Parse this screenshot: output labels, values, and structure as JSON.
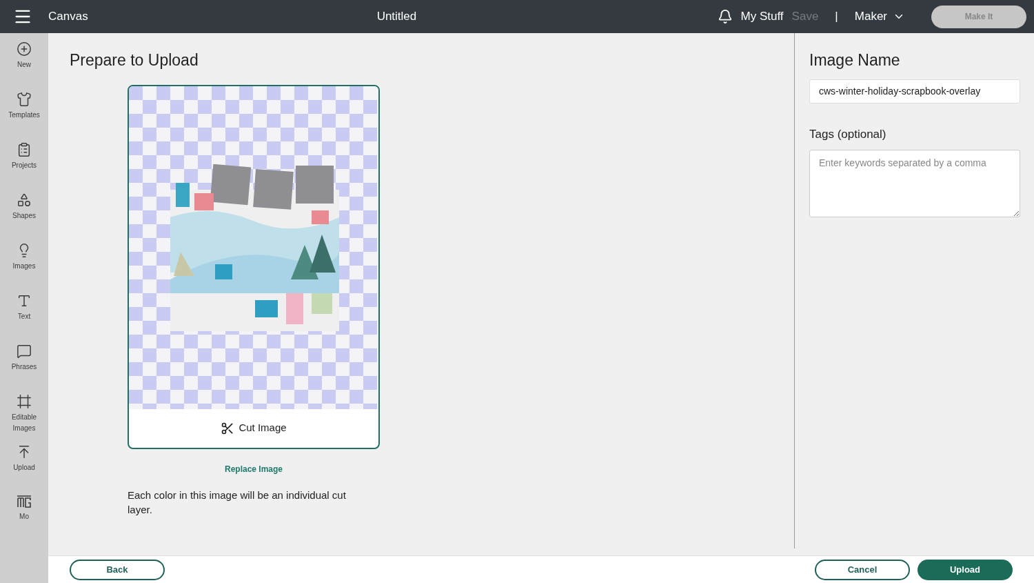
{
  "header": {
    "app_title": "Canvas",
    "document_title": "Untitled",
    "my_stuff": "My Stuff",
    "save": {
      "label": "Save",
      "disabled": true
    },
    "separator": "|",
    "machine": "Maker",
    "make_it": {
      "label": "Make It",
      "disabled": true
    }
  },
  "sidebar": {
    "items": [
      {
        "label": "New"
      },
      {
        "label": "Templates"
      },
      {
        "label": "Projects"
      },
      {
        "label": "Shapes"
      },
      {
        "label": "Images"
      },
      {
        "label": "Text"
      },
      {
        "label": "Phrases"
      },
      {
        "label": "Editable Images"
      },
      {
        "label": "Upload"
      },
      {
        "label": "Mo"
      }
    ]
  },
  "main": {
    "title": "Prepare to Upload",
    "cut_option": "Cut Image",
    "replace_link": "Replace Image",
    "note": "Each color in this image will be an individual cut layer."
  },
  "side_panel": {
    "name_label": "Image Name",
    "name_value": "cws-winter-holiday-scrapbook-overlay",
    "tags_label": "Tags (optional)",
    "tags_placeholder": "Enter keywords separated by a comma"
  },
  "footer": {
    "back": "Back",
    "cancel": "Cancel",
    "upload": "Upload"
  }
}
